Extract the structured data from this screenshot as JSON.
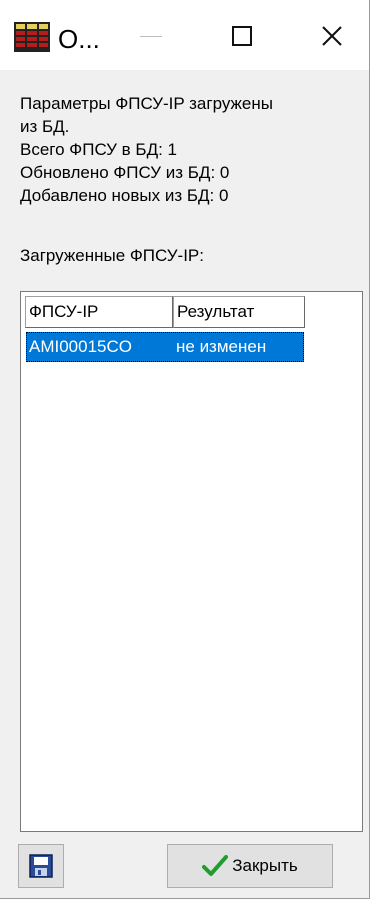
{
  "window": {
    "title": "О...",
    "title_icon": "grid-app-icon",
    "controls": {
      "minimize": "minimize-icon",
      "maximize": "maximize-icon",
      "close": "close-icon"
    }
  },
  "info": {
    "line1": "Параметры ФПСУ-IP загружены",
    "line2": "из БД.",
    "line3": "Всего ФПСУ в БД: 1",
    "line4": "Обновлено ФПСУ из БД: 0",
    "line5": "Добавлено новых из БД: 0"
  },
  "list": {
    "label": "Загруженные ФПСУ-IP:",
    "columns": [
      "ФПСУ-IP",
      "Результат"
    ],
    "rows": [
      [
        "AMI00015CO",
        "не изменен"
      ]
    ],
    "selection_color": "#0078d7"
  },
  "buttons": {
    "save_icon": "floppy-disk-icon",
    "close_icon": "green-check-icon",
    "close_label": "Закрыть"
  }
}
